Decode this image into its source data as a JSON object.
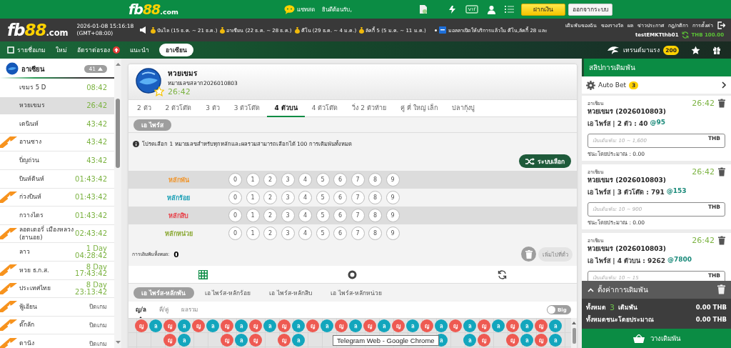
{
  "top_bar": {
    "logo": {
      "prefix": "fb",
      "accent": "88",
      "suffix": ".com"
    },
    "chat": "แชทสด",
    "welcome": "ยินดีต้อนรับ,",
    "deposit": "ฝากเงิน",
    "logout": "ออกจากระบบ"
  },
  "info_bar": {
    "logo": {
      "prefix": "fb",
      "accent": "88",
      "suffix": ".com"
    },
    "datetime": "2026-01-08 15:16:18",
    "timezone": "(GMT+08:00)",
    "ticker": [
      "ปันไล (15 ธ.ค. ~ 21 ธ.ค.)",
      "อาเซียน (22 ธ.ค. ~ 28 ธ.ค.)",
      "คีโน (29 ธ.ค. ~ 4 ม.ค.)",
      "ลัคกี้ 5 (5 ม.ค. ~ 11 ม.ค.)"
    ],
    "announcement": "มอลลาเปิดให้บริการแล้วใน คีโน,ลัคกี้ 28 และ",
    "links": [
      "เดิมพันของฉัน",
      "ของรางวัล",
      "ผล",
      "ข่าวประกาศ",
      "กฎ/กติกา",
      "การตั้งค่า"
    ],
    "username": "testEMKTthb01",
    "balance": "THB 100.00"
  },
  "nav": {
    "items": [
      {
        "label": "รายชื่อเกม",
        "kind": "list",
        "selected": false
      },
      {
        "label": "ใหม่",
        "kind": "plain",
        "selected": false
      },
      {
        "label": "อัตราต่อรอง",
        "kind": "hot",
        "selected": false
      },
      {
        "label": "แนะนำ",
        "kind": "plain",
        "selected": false
      },
      {
        "label": "อาเซียน",
        "kind": "plain",
        "selected": true
      }
    ],
    "trending": {
      "label": "เทรนด์มาแรง",
      "count": "200"
    }
  },
  "sidebar": {
    "title": "อาเซียน",
    "count": "41",
    "expanded": true,
    "items": [
      {
        "name": "เขมร 5 D",
        "time": "08:42",
        "hot": false,
        "selected": false,
        "closed": false
      },
      {
        "name": "หวยเขมร",
        "time": "26:42",
        "hot": false,
        "selected": true,
        "closed": false
      },
      {
        "name": "เดนินห์",
        "time": "43:42",
        "hot": false,
        "selected": false,
        "closed": false
      },
      {
        "name": "อานซาง",
        "time": "43:42",
        "hot": true,
        "selected": false,
        "closed": false
      },
      {
        "name": "บิ่ญถ่วน",
        "time": "43:42",
        "hot": false,
        "selected": false,
        "closed": false
      },
      {
        "name": "บินห์ดินห์",
        "time": "01:43:42",
        "hot": false,
        "selected": false,
        "closed": false
      },
      {
        "name": "ก่วงบินห์",
        "time": "01:43:42",
        "hot": true,
        "selected": false,
        "closed": false
      },
      {
        "name": "กวางไตร",
        "time": "01:43:42",
        "hot": false,
        "selected": false,
        "closed": false
      },
      {
        "name": "ลอตเตอรี่ เมืองหลวง (ฮานอย)",
        "time": "02:43:42",
        "hot": true,
        "selected": false,
        "closed": false
      },
      {
        "name": "ลาว",
        "day": "1 Day",
        "time": "04:28:42",
        "hot": false,
        "selected": false,
        "closed": false
      },
      {
        "name": "หวย ธ.ก.ส.",
        "day": "8 Day",
        "time": "17:43:42",
        "hot": true,
        "selected": false,
        "closed": false
      },
      {
        "name": "ประเทศไทย",
        "day": "8 Day",
        "time": "23:13:42",
        "hot": true,
        "selected": false,
        "closed": false
      },
      {
        "name": "ฟู้เอียน",
        "time": "ปิดเกม",
        "hot": true,
        "selected": false,
        "closed": true
      },
      {
        "name": "ดั๊กลัก",
        "time": "ปิดเกม",
        "hot": true,
        "selected": false,
        "closed": true
      },
      {
        "name": "ดานัง",
        "time": "ปิดเกม",
        "hot": true,
        "selected": false,
        "closed": true
      }
    ]
  },
  "game": {
    "name": "หวยเขมร",
    "draw": "หมายเลขสลาก2026010803",
    "countdown": "26:42",
    "bet_types": [
      {
        "label": "2 ตัว",
        "selected": false
      },
      {
        "label": "2 ตัวโต๊ด",
        "selected": false
      },
      {
        "label": "3 ตัว",
        "selected": false
      },
      {
        "label": "3 ตัวโต๊ด",
        "selected": false
      },
      {
        "label": "4 ตัวบน",
        "selected": true
      },
      {
        "label": "4 ตัวโต๊ด",
        "selected": false
      },
      {
        "label": "วิ่ง 2 ตัวท้าย",
        "selected": false
      },
      {
        "label": "คู่ คี่ ใหญ่ เล็ก",
        "selected": false
      },
      {
        "label": "ปลากุ้งปู",
        "selected": false
      }
    ],
    "sub_types": [
      {
        "label": "เอ ไพร์ส",
        "selected": true
      }
    ],
    "notice": "โปรดเลือก 1 หมายเลขสำหรับทุกหลักและผลรวมสามารถเลือกได้ 100 การเดิมพันทั้งหมด",
    "random_button": "ระบบเลือก",
    "positions": [
      {
        "label": "หลักพัน",
        "color": "#f0962e",
        "digits": [
          {
            "label": "0",
            "selected": false
          },
          {
            "label": "1",
            "selected": false
          },
          {
            "label": "2",
            "selected": false
          },
          {
            "label": "3",
            "selected": false
          },
          {
            "label": "4",
            "selected": false
          },
          {
            "label": "5",
            "selected": false
          },
          {
            "label": "6",
            "selected": false
          },
          {
            "label": "7",
            "selected": false
          },
          {
            "label": "8",
            "selected": false
          },
          {
            "label": "9",
            "selected": false
          }
        ]
      },
      {
        "label": "หลักร้อย",
        "color": "#1a9fb5",
        "digits": [
          {
            "label": "0",
            "selected": false
          },
          {
            "label": "1",
            "selected": false
          },
          {
            "label": "2",
            "selected": false
          },
          {
            "label": "3",
            "selected": false
          },
          {
            "label": "4",
            "selected": false
          },
          {
            "label": "5",
            "selected": false
          },
          {
            "label": "6",
            "selected": false
          },
          {
            "label": "7",
            "selected": false
          },
          {
            "label": "8",
            "selected": false
          },
          {
            "label": "9",
            "selected": false
          }
        ]
      },
      {
        "label": "หลักสิบ",
        "color": "#e8424a",
        "digits": [
          {
            "label": "0",
            "selected": false
          },
          {
            "label": "1",
            "selected": false
          },
          {
            "label": "2",
            "selected": false
          },
          {
            "label": "3",
            "selected": false
          },
          {
            "label": "4",
            "selected": false
          },
          {
            "label": "5",
            "selected": false
          },
          {
            "label": "6",
            "selected": false
          },
          {
            "label": "7",
            "selected": false
          },
          {
            "label": "8",
            "selected": false
          },
          {
            "label": "9",
            "selected": false
          }
        ]
      },
      {
        "label": "หลักหน่วย",
        "color": "#8aa832",
        "digits": [
          {
            "label": "0",
            "selected": false
          },
          {
            "label": "1",
            "selected": false
          },
          {
            "label": "2",
            "selected": false
          },
          {
            "label": "3",
            "selected": false
          },
          {
            "label": "4",
            "selected": false
          },
          {
            "label": "5",
            "selected": false
          },
          {
            "label": "6",
            "selected": false
          },
          {
            "label": "7",
            "selected": false
          },
          {
            "label": "8",
            "selected": false
          },
          {
            "label": "9",
            "selected": false
          }
        ]
      }
    ],
    "total_label": "การเดิมพันทั้งหมด:",
    "total_value": "0",
    "add_button": {
      "label": "เพิ่มไปที่ตั๋ว",
      "disabled": true
    },
    "stats_tabs": [
      {
        "kind": "grid",
        "selected": true
      },
      {
        "kind": "donut",
        "selected": false
      },
      {
        "kind": "refresh",
        "selected": false
      }
    ],
    "road_tabs": [
      {
        "label": "เอ ไพร์ส-หลักพัน",
        "selected": true
      },
      {
        "label": "เอ ไพร์ส-หลักร้อย",
        "selected": false
      },
      {
        "label": "เอ ไพร์ส-หลักสิบ",
        "selected": false
      },
      {
        "label": "เอ ไพร์ส-หลักหน่วย",
        "selected": false
      }
    ],
    "road_modes": [
      {
        "label": "ญ/ล",
        "selected": true
      },
      {
        "label": "คี่/คู่",
        "selected": false
      },
      {
        "label": "ผลรวม",
        "selected": false
      }
    ],
    "big_toggle": {
      "label": "Big",
      "on": false
    },
    "road": [
      [
        {
          "label": "ญ",
          "color": "#ee5a52"
        }
      ],
      [
        {
          "label": "ล",
          "color": "#13a6bd"
        }
      ],
      [
        {
          "label": "ญ",
          "color": "#ee5a52"
        },
        {
          "label": "ญ",
          "color": "#ee5a52"
        }
      ],
      [
        {
          "label": "ล",
          "color": "#13a6bd"
        },
        {
          "label": "ล",
          "color": "#13a6bd"
        }
      ],
      [
        {
          "label": "ญ",
          "color": "#ee5a52"
        }
      ],
      [
        {
          "label": "ล",
          "color": "#13a6bd"
        }
      ],
      [
        {
          "label": "ญ",
          "color": "#ee5a52"
        },
        {
          "label": "ญ",
          "color": "#ee5a52"
        }
      ],
      [
        {
          "label": "ล",
          "color": "#13a6bd"
        },
        {
          "label": "ล",
          "color": "#13a6bd"
        }
      ],
      [
        {
          "label": "ญ",
          "color": "#ee5a52"
        },
        {
          "label": "ญ",
          "color": "#ee5a52"
        }
      ],
      [
        {
          "label": "ล",
          "color": "#13a6bd"
        }
      ],
      [
        {
          "label": "ญ",
          "color": "#ee5a52"
        },
        {
          "label": "ญ",
          "color": "#ee5a52"
        }
      ],
      [
        {
          "label": "ล",
          "color": "#13a6bd"
        },
        {
          "label": "ล",
          "color": "#13a6bd"
        }
      ],
      [
        {
          "label": "ญ",
          "color": "#ee5a52"
        }
      ],
      [
        {
          "label": "ล",
          "color": "#13a6bd"
        }
      ],
      [
        {
          "label": "ญ",
          "color": "#ee5a52"
        }
      ],
      [
        {
          "label": "ล",
          "color": "#13a6bd"
        }
      ],
      [
        {
          "label": "ญ",
          "color": "#ee5a52"
        }
      ],
      [
        {
          "label": "ล",
          "color": "#13a6bd"
        }
      ],
      [
        {
          "label": "ญ",
          "color": "#ee5a52"
        }
      ],
      [
        {
          "label": "ล",
          "color": "#13a6bd"
        }
      ],
      [
        {
          "label": "ญ",
          "color": "#ee5a52"
        }
      ],
      [
        {
          "label": "ล",
          "color": "#13a6bd"
        },
        {
          "label": "ล",
          "color": "#13a6bd"
        }
      ],
      [
        {
          "label": "ญ",
          "color": "#ee5a52"
        }
      ],
      [
        {
          "label": "ล",
          "color": "#13a6bd"
        },
        {
          "label": "ล",
          "color": "#13a6bd"
        }
      ],
      [
        {
          "label": "ญ",
          "color": "#ee5a52"
        },
        {
          "label": "ญ",
          "color": "#ee5a52"
        }
      ],
      [
        {
          "label": "ล",
          "color": "#13a6bd"
        }
      ],
      [
        {
          "label": "ญ",
          "color": "#ee5a52"
        },
        {
          "label": "ญ",
          "color": "#ee5a52"
        }
      ],
      [
        {
          "label": "ล",
          "color": "#13a6bd"
        },
        {
          "label": "ล",
          "color": "#13a6bd"
        }
      ],
      [
        {
          "label": "ญ",
          "color": "#ee5a52"
        },
        {
          "label": "ญ",
          "color": "#ee5a52"
        }
      ],
      [
        {
          "label": "ล",
          "color": "#13a6bd"
        },
        {
          "label": "ล",
          "color": "#13a6bd"
        }
      ]
    ],
    "tooltip": "Telegram Web - Google Chrome"
  },
  "bet_slip": {
    "title": "สลิปการเดิมพัน",
    "auto_bet": {
      "label": "Auto Bet",
      "count": "3"
    },
    "bets": [
      {
        "category": "อาเซียน",
        "title": "หวยเขมร (2026010803)",
        "countdown": "26:42",
        "selection": "เอ ไพร์ส | 2 ตัว : 40",
        "odds": "@95",
        "placeholder": "เงินเดิมพัน: 10 ~ 1,600",
        "currency": "THB",
        "estimate": "ชนะโดยประมาณ : 0.00"
      },
      {
        "category": "อาเซียน",
        "title": "หวยเขมร (2026010803)",
        "countdown": "26:42",
        "selection": "เอ ไพร์ส | 3 ตัวโต๊ด : 791",
        "odds": "@153",
        "placeholder": "เงินเดิมพัน: 10 ~ 900",
        "currency": "THB",
        "estimate": "ชนะโดยประมาณ : 0.00"
      },
      {
        "category": "อาเซียน",
        "title": "หวยเขมร (2026010803)",
        "countdown": "26:42",
        "selection": "เอ ไพร์ส | 4 ตัวบน : 9262",
        "odds": "@7800",
        "placeholder": "เงินเดิมพัน: 10 ~ 15",
        "currency": "THB"
      }
    ],
    "settings": {
      "label": "ตั้งค่าการเดิมพัน",
      "expanded": true
    },
    "total_label": "ทั้งหมด",
    "total_count": "3",
    "total_unit": "เดิมพัน",
    "total_amount": "0.00 THB",
    "win_label": "ทั้งหมดชนะโดยประมาณ",
    "win_amount": "0.00 THB",
    "place_button": "วางเดิมพัน"
  }
}
